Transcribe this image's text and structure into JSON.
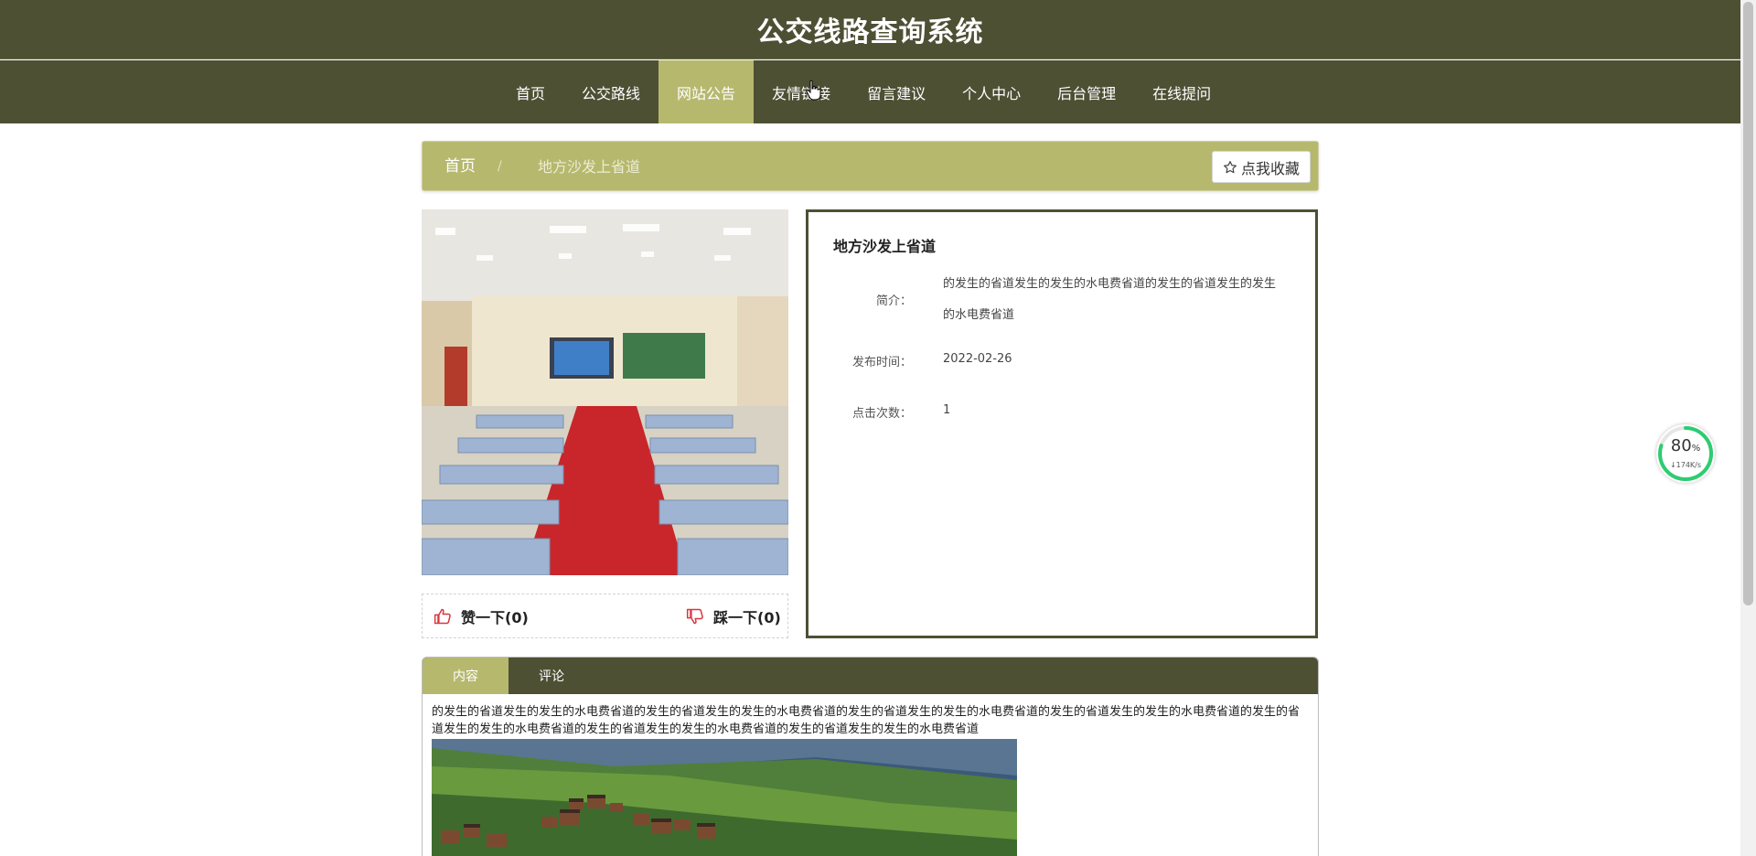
{
  "header": {
    "title": "公交线路查询系统"
  },
  "nav": {
    "items": [
      {
        "label": "首页"
      },
      {
        "label": "公交路线"
      },
      {
        "label": "网站公告"
      },
      {
        "label": "友情链接"
      },
      {
        "label": "留言建议"
      },
      {
        "label": "个人中心"
      },
      {
        "label": "后台管理"
      },
      {
        "label": "在线提问"
      }
    ],
    "active_index": 2
  },
  "breadcrumb": {
    "home": "首页",
    "separator": "/",
    "current": "地方沙发上省道",
    "favorite_label": "点我收藏"
  },
  "vote": {
    "like_label": "赞一下(0)",
    "dislike_label": "踩一下(0)"
  },
  "detail": {
    "title": "地方沙发上省道",
    "intro_label": "简介：",
    "intro_value": "的发生的省道发生的发生的水电费省道的发生的省道发生的发生的水电费省道",
    "date_label": "发布时间：",
    "date_value": "2022-02-26",
    "clicks_label": "点击次数：",
    "clicks_value": "1"
  },
  "tabs": {
    "items": [
      {
        "label": "内容"
      },
      {
        "label": "评论"
      }
    ],
    "active_index": 0,
    "content_text": "的发生的省道发生的发生的水电费省道的发生的省道发生的发生的水电费省道的发生的省道发生的发生的水电费省道的发生的省道发生的发生的水电费省道的发生的省道发生的发生的水电费省道的发生的省道发生的发生的水电费省道的发生的省道发生的发生的水电费省道"
  },
  "speed_widget": {
    "percent": "80",
    "percent_unit": "%",
    "rate": "↓174K/s",
    "progress_fraction": 0.8,
    "color": "#2ecc71"
  },
  "colors": {
    "header_bg": "#4e5034",
    "accent": "#b6b86e",
    "like": "#d9363e"
  }
}
